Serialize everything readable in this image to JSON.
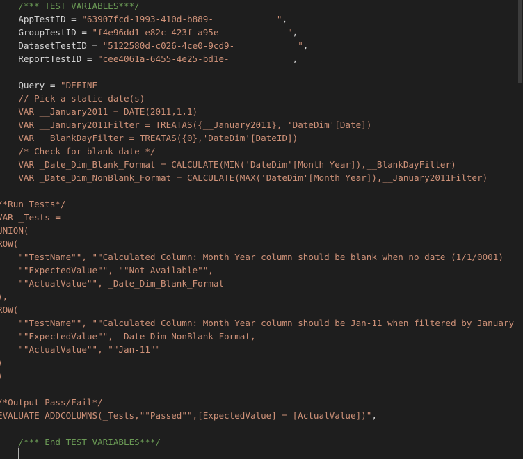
{
  "editor": {
    "lines": [
      {
        "indent": "    ",
        "parts": [
          {
            "t": "/*** TEST VARIABLES***/",
            "k": "c"
          }
        ]
      },
      {
        "indent": "    ",
        "parts": [
          {
            "t": "AppTestID = ",
            "k": "p"
          },
          {
            "t": "\"63907fcd-1993-410d-b889-            \"",
            "k": "s"
          },
          {
            "t": ",",
            "k": "p"
          }
        ]
      },
      {
        "indent": "    ",
        "parts": [
          {
            "t": "GroupTestID = ",
            "k": "p"
          },
          {
            "t": "\"f4e96dd1-e82c-423f-a95e-            \"",
            "k": "s"
          },
          {
            "t": ",",
            "k": "p"
          }
        ]
      },
      {
        "indent": "    ",
        "parts": [
          {
            "t": "DatasetTestID = ",
            "k": "p"
          },
          {
            "t": "\"5122580d-c026-4ce0-9cd9-            \"",
            "k": "s"
          },
          {
            "t": ",",
            "k": "p"
          }
        ]
      },
      {
        "indent": "    ",
        "parts": [
          {
            "t": "ReportTestID = ",
            "k": "p"
          },
          {
            "t": "\"cee4061a-6455-4e25-bd1e-            ",
            "k": "s"
          },
          {
            "t": ",",
            "k": "p"
          }
        ]
      },
      {
        "indent": "",
        "parts": []
      },
      {
        "indent": "    ",
        "parts": [
          {
            "t": "Query = ",
            "k": "p"
          },
          {
            "t": "\"DEFINE",
            "k": "s"
          }
        ]
      },
      {
        "indent": "    ",
        "parts": [
          {
            "t": "// Pick a static date(s)",
            "k": "s"
          }
        ]
      },
      {
        "indent": "    ",
        "parts": [
          {
            "t": "VAR __January2011 = DATE(2011,1,1)",
            "k": "s"
          }
        ]
      },
      {
        "indent": "    ",
        "parts": [
          {
            "t": "VAR __January2011Filter = TREATAS({__January2011}, 'DateDim'[Date])",
            "k": "s"
          }
        ]
      },
      {
        "indent": "    ",
        "parts": [
          {
            "t": "VAR __BlankDayFilter = TREATAS({0},'DateDim'[DateID])",
            "k": "s"
          }
        ]
      },
      {
        "indent": "    ",
        "parts": [
          {
            "t": "/* Check for blank date */",
            "k": "s"
          }
        ]
      },
      {
        "indent": "    ",
        "parts": [
          {
            "t": "VAR _Date_Dim_Blank_Format = CALCULATE(MIN('DateDim'[Month Year]),__BlankDayFilter)",
            "k": "s"
          }
        ]
      },
      {
        "indent": "    ",
        "parts": [
          {
            "t": "VAR _Date_Dim_NonBlank_Format = CALCULATE(MAX('DateDim'[Month Year]),__January2011Filter)",
            "k": "s"
          }
        ]
      },
      {
        "indent": "",
        "parts": []
      },
      {
        "indent": "",
        "parts": [
          {
            "t": "/*Run Tests*/",
            "k": "s"
          }
        ]
      },
      {
        "indent": "",
        "parts": [
          {
            "t": "VAR _Tests =",
            "k": "s"
          }
        ]
      },
      {
        "indent": "",
        "parts": [
          {
            "t": "UNION(",
            "k": "s"
          }
        ]
      },
      {
        "indent": "",
        "parts": [
          {
            "t": "ROW(",
            "k": "s"
          }
        ]
      },
      {
        "indent": "    ",
        "parts": [
          {
            "t": "\"\"TestName\"\", \"\"Calculated Column: Month Year column should be blank when no date (1/1/0001)",
            "k": "s"
          }
        ]
      },
      {
        "indent": "    ",
        "parts": [
          {
            "t": "\"\"ExpectedValue\"\", \"\"Not Available\"\",",
            "k": "s"
          }
        ]
      },
      {
        "indent": "    ",
        "parts": [
          {
            "t": "\"\"ActualValue\"\", _Date_Dim_Blank_Format",
            "k": "s"
          }
        ]
      },
      {
        "indent": "",
        "parts": [
          {
            "t": "),",
            "k": "s"
          }
        ]
      },
      {
        "indent": "",
        "parts": [
          {
            "t": "ROW(",
            "k": "s"
          }
        ]
      },
      {
        "indent": "    ",
        "parts": [
          {
            "t": "\"\"TestName\"\", \"\"Calculated Column: Month Year column should be Jan-11 when filtered by January",
            "k": "s"
          }
        ]
      },
      {
        "indent": "    ",
        "parts": [
          {
            "t": "\"\"ExpectedValue\"\", _Date_Dim_NonBlank_Format,",
            "k": "s"
          }
        ]
      },
      {
        "indent": "    ",
        "parts": [
          {
            "t": "\"\"ActualValue\"\", \"\"Jan-11\"\"",
            "k": "s"
          }
        ]
      },
      {
        "indent": "",
        "parts": [
          {
            "t": ")",
            "k": "s"
          }
        ]
      },
      {
        "indent": "",
        "parts": [
          {
            "t": ")",
            "k": "s"
          }
        ]
      },
      {
        "indent": "",
        "parts": []
      },
      {
        "indent": "",
        "parts": [
          {
            "t": "/*Output Pass/Fail*/",
            "k": "s"
          }
        ]
      },
      {
        "indent": "",
        "parts": [
          {
            "t": "EVALUATE ADDCOLUMNS(_Tests,\"\"Passed\"\",[ExpectedValue] = [ActualValue])\"",
            "k": "s"
          },
          {
            "t": ",",
            "k": "p"
          }
        ]
      },
      {
        "indent": "",
        "parts": []
      },
      {
        "indent": "    ",
        "parts": [
          {
            "t": "/*** End TEST VARIABLES***/",
            "k": "c"
          }
        ]
      },
      {
        "indent": "",
        "parts": []
      }
    ]
  },
  "colors": {
    "background": "#1e1e1e",
    "comment": "#6a9955",
    "string": "#ce9178",
    "plain": "#d4d4d4"
  }
}
